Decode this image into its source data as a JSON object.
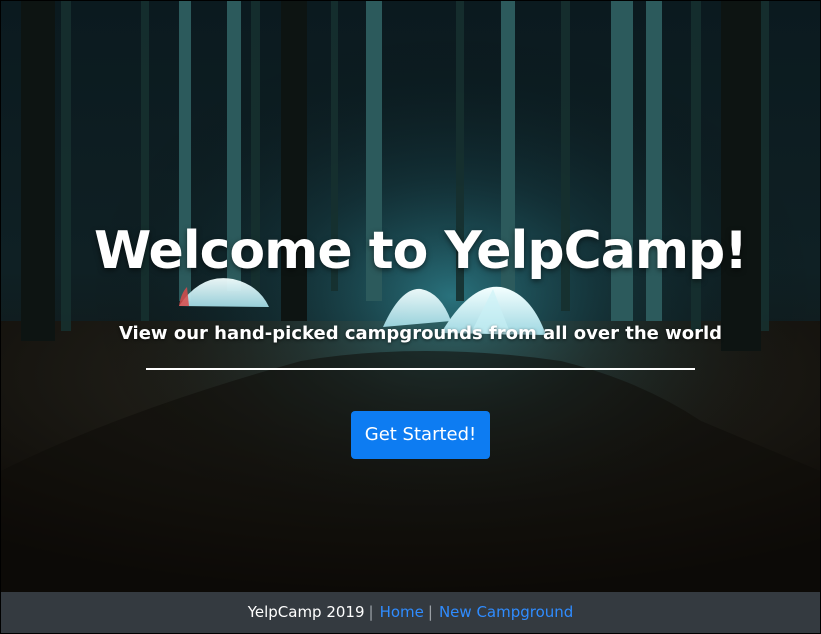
{
  "hero": {
    "title": "Welcome to YelpCamp!",
    "subtitle": "View our hand-picked campgrounds from all over the world",
    "cta_label": "Get Started!"
  },
  "footer": {
    "copyright": "YelpCamp 2019",
    "separator": "|",
    "links": [
      {
        "label": "Home"
      },
      {
        "label": "New Campground"
      }
    ]
  },
  "colors": {
    "cta_bg": "#0d7cf2",
    "footer_bg": "#343a40",
    "link": "#2f8cff"
  },
  "icons": {
    "background": "forest-campsite-night-photo"
  }
}
